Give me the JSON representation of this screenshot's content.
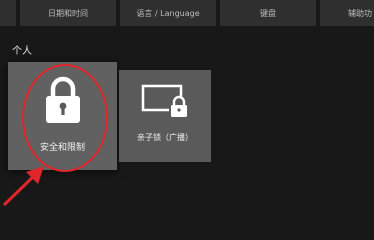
{
  "top_row": [
    {
      "label": ""
    },
    {
      "label": "日期和时间"
    },
    {
      "label": "语言 / Language"
    },
    {
      "label": "键盘"
    },
    {
      "label": "辅助功"
    }
  ],
  "section": {
    "title": "个人"
  },
  "tiles": [
    {
      "label": "安全和限制",
      "icon": "lock-icon",
      "selected": true
    },
    {
      "label": "亲子锁（广播）",
      "icon": "screen-lock-icon",
      "selected": false
    }
  ],
  "annotation": {
    "color": "#e0262b"
  }
}
